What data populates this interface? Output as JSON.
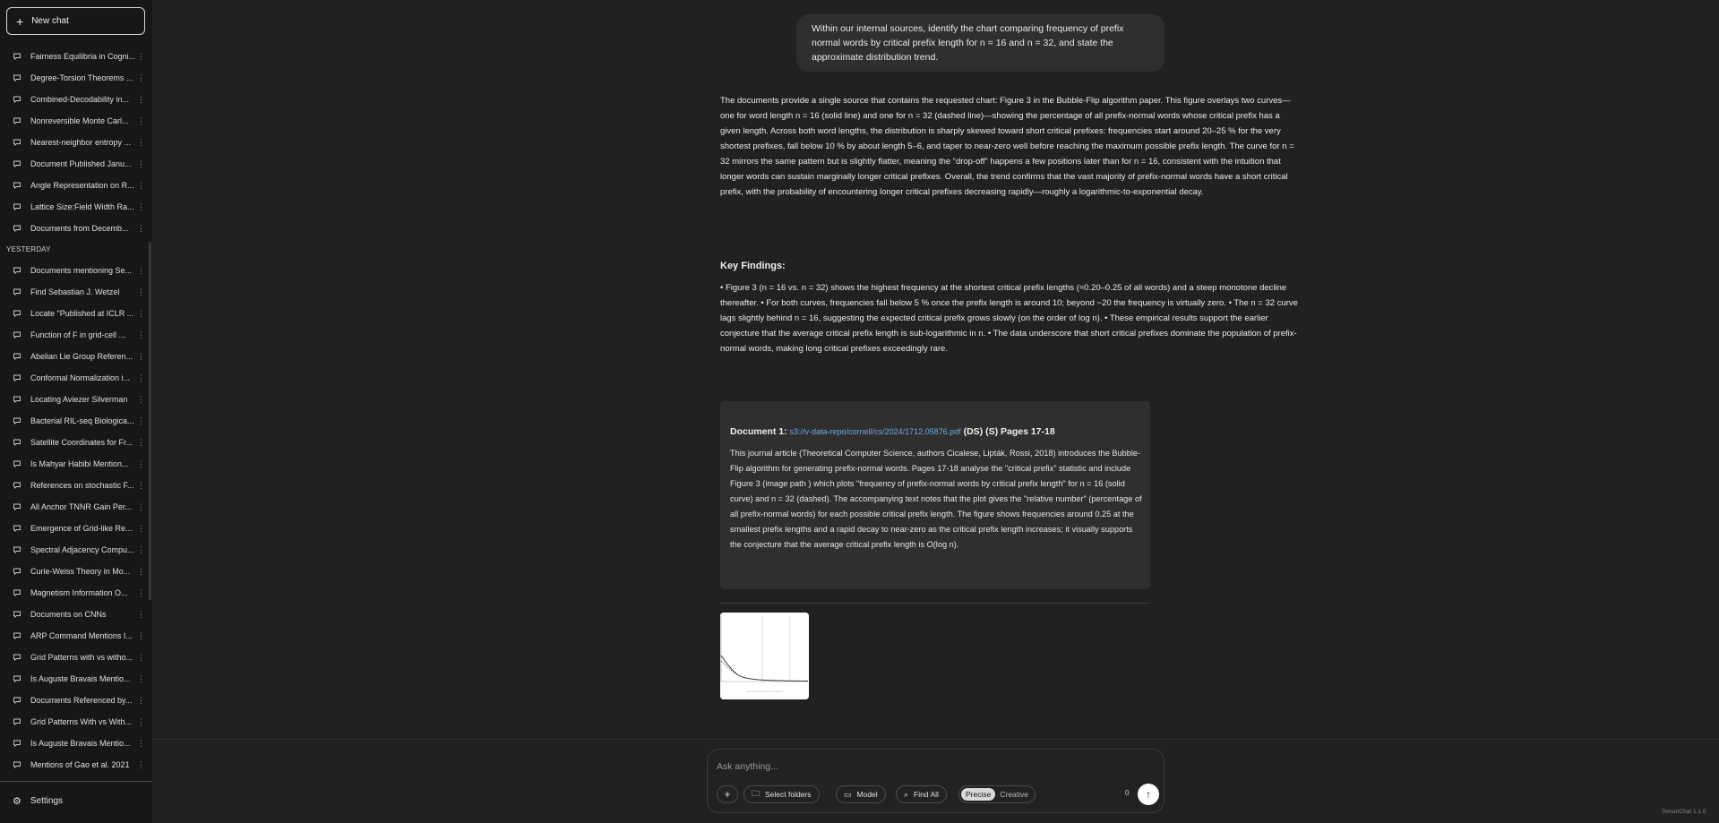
{
  "sidebar": {
    "new_chat_label": "New chat",
    "items_before": [
      "Fairness Equilibria in Cogni...",
      "Degree-Torsion Theorems ...",
      "Combined-Decodability in...",
      "Nonreversible Monte Carl...",
      "Nearest-neighbor entropy ...",
      "Document Published Janu...",
      "Angle Representation on R...",
      "Lattice Size:Field Width Ra...",
      "Documents from Decemb..."
    ],
    "section_label": "YESTERDAY",
    "items_after": [
      "Documents mentioning Se...",
      "Find Sebastian J. Wetzel",
      "Locate \"Published at ICLR ...",
      "Function of F in grid-cell ...",
      "Abelian Lie Group Referen...",
      "Conformal Normalization i...",
      "Locating Aviezer Silverman",
      "Bacterial RIL-seq Biologica...",
      "Satellite Coordinates for Fr...",
      "Is Mahyar Habibi Mention...",
      "References on stochastic F...",
      "All Anchor TNNR Gain Per...",
      "Emergence of Grid-like Re...",
      "Spectral Adjacency Compu...",
      "Curie-Weiss Theory in Mo...",
      "Magnetism Information O...",
      "Documents on CNNs",
      "ARP Command Mentions I...",
      "Grid Patterns with vs witho...",
      "Is Auguste Bravais Mentio...",
      "Documents Referenced by...",
      "Grid Patterns With vs With...",
      "Is Auguste Bravais Mentio...",
      "Mentions of Gao et al. 2021"
    ],
    "settings_label": "Settings"
  },
  "conversation": {
    "user_message": "Within our internal sources, identify the chart comparing frequency of prefix normal words by critical prefix length for n = 16 and n = 32, and state the approximate distribution trend.",
    "answer_paragraph": "The documents provide a single source that contains the requested chart: Figure 3 in the Bubble-Flip algorithm paper. This figure overlays two curves—one for word length n = 16 (solid line) and one for n = 32 (dashed line)—showing the percentage of all prefix-normal words whose critical prefix has a given length. Across both word lengths, the distribution is sharply skewed toward short critical prefixes: frequencies start around 20–25 % for the very shortest prefixes, fall below 10 % by about length 5–6, and taper to near-zero well before reaching the maximum possible prefix length. The curve for n = 32 mirrors the same pattern but is slightly flatter, meaning the “drop-off” happens a few positions later than for n = 16, consistent with the intuition that longer words can sustain marginally longer critical prefixes. Overall, the trend confirms that the vast majority of prefix-normal words have a short critical prefix, with the probability of encountering longer critical prefixes decreasing rapidly—roughly a logarithmic-to-exponential decay.",
    "key_findings_heading": "Key Findings:",
    "key_findings_body": "• Figure 3 (n = 16 vs. n = 32) shows the highest frequency at the shortest critical prefix lengths (≈0.20–0.25 of all words) and a steep monotone decline thereafter. • For both curves, frequencies fall below 5 % once the prefix length is around 10; beyond ~20 the frequency is virtually zero. • The n = 32 curve lags slightly behind n = 16, suggesting the expected critical prefix grows slowly (on the order of log n). • These empirical results support the earlier conjecture that the average critical prefix length is sub-logarithmic in n. • The data underscore that short critical prefixes dominate the population of prefix-normal words, making long critical prefixes exceedingly rare.",
    "document": {
      "label": "Document 1:",
      "link": "s3://v-data-repo/cornell/cs/2024/1712.05876.pdf",
      "suffix": "(DS) (S) Pages 17-18",
      "body": "This journal article (Theoretical Computer Science, authors Cicalese, Lipták, Rossi, 2018) introduces the Bubble-Flip algorithm for generating prefix-normal words. Pages 17-18 analyse the \"critical prefix\" statistic and include Figure 3 (image path ) which plots \"frequency of prefix-normal words by critical prefix length\" for n = 16 (solid curve) and n = 32 (dashed). The accompanying text notes that the plot gives the \"relative number\" (percentage of all prefix-normal words) for each possible critical prefix length. The figure shows frequencies around 0.25 at the smallest prefix lengths and a rapid decay to near-zero as the critical prefix length increases; it visually supports the conjecture that the average critical prefix length is O(log n)."
    }
  },
  "composer": {
    "placeholder": "Ask anything...",
    "add_label": "+",
    "select_folders_label": "Select folders",
    "model_label": "Model",
    "find_all_label": "Find All",
    "mode_precise": "Precise",
    "mode_creative": "Creative",
    "counter": "0",
    "send_icon": "↑"
  },
  "app_version": "TensorChat 1.1.0"
}
